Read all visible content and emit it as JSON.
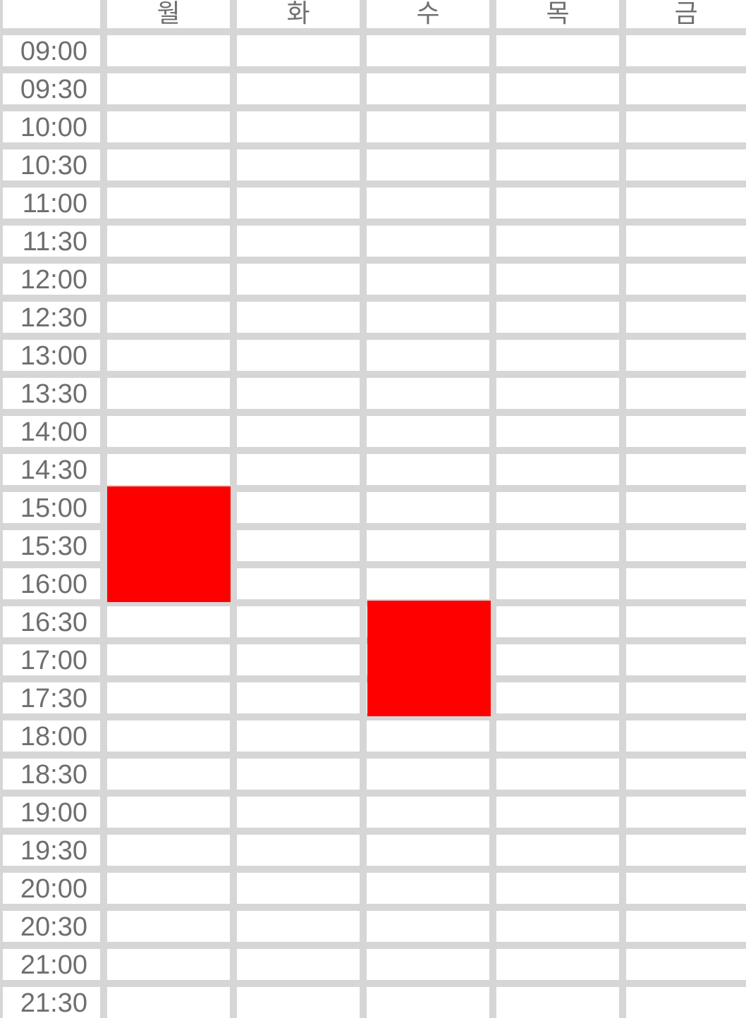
{
  "timetable": {
    "days": [
      "월",
      "화",
      "수",
      "목",
      "금"
    ],
    "times": [
      "09:00",
      "09:30",
      "10:00",
      "10:30",
      "11:00",
      "11:30",
      "12:00",
      "12:30",
      "13:00",
      "13:30",
      "14:00",
      "14:30",
      "15:00",
      "15:30",
      "16:00",
      "16:30",
      "17:00",
      "17:30",
      "18:00",
      "18:30",
      "19:00",
      "19:30",
      "20:00",
      "20:30",
      "21:00",
      "21:30"
    ],
    "events": [
      {
        "day": "월",
        "start": "15:00",
        "end": "16:30",
        "color": "#ff0000"
      },
      {
        "day": "수",
        "start": "16:30",
        "end": "18:00",
        "color": "#ff0000"
      }
    ]
  },
  "colors": {
    "grid_line": "#d6d6d6",
    "cell_background": "#ffffff",
    "label_text": "#6e6e6e",
    "event_fill": "#ff0000"
  }
}
